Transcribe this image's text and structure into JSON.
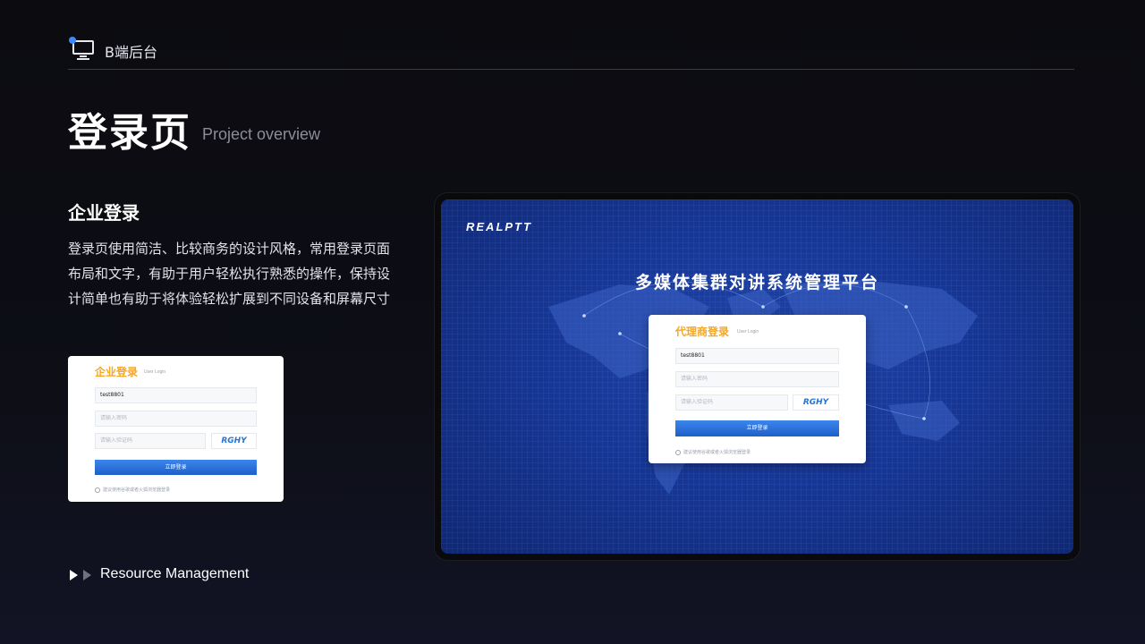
{
  "header": {
    "icon": "monitor-icon",
    "brand": "B端后台"
  },
  "page": {
    "title": "登录页",
    "subtitle": "Project overview"
  },
  "section": {
    "title": "企业登录",
    "description": "登录页使用简洁、比较商务的设计风格，常用登录页面布局和文字，有助于用户轻松执行熟悉的操作，保持设计简单也有助于将体验轻松扩展到不同设备和屏幕尺寸"
  },
  "enterprise_login": {
    "title": "企业登录",
    "subtitle": "User Login",
    "username_value": "test8801",
    "password_placeholder": "请输入密码",
    "captcha_placeholder": "请输入验证码",
    "captcha_text": "RGHY",
    "submit_label": "立即登录",
    "tip": "建议使用谷歌或者火狐浏览器登录"
  },
  "footer": {
    "label": "Resource Management"
  },
  "platform": {
    "logo": "REALPTT",
    "title": "多媒体集群对讲系统管理平台",
    "login": {
      "title": "代理商登录",
      "subtitle": "User Login",
      "username_value": "test8801",
      "password_placeholder": "请输入密码",
      "captcha_placeholder": "请输入验证码",
      "captcha_text": "RGHY",
      "submit_label": "立即登录",
      "tip": "建议使用谷歌或者火狐浏览器登录"
    }
  },
  "colors": {
    "accent": "#f5a623",
    "button": "#2c74de",
    "screen_bg": "#173796"
  }
}
